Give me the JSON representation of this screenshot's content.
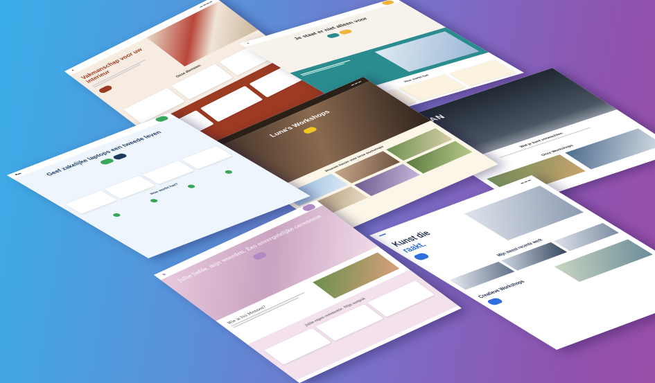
{
  "mockups": {
    "vakmanschap": {
      "headline": "Vakmanschap voor uw interieur",
      "section_title": "Onze diensten",
      "colors": {
        "primary": "#9c3a22",
        "bg": "#f6ece2"
      }
    },
    "coaching": {
      "headline": "Je staat er niet alleen voor",
      "section_title": "Hoe werkt het",
      "colors": {
        "primary": "#2a8c8f",
        "accent": "#f0b43c"
      }
    },
    "urban": {
      "headline": "URBAN",
      "section_title": "Wat je kunt verwachten",
      "section2_title": "Onze Workshops",
      "colors": {
        "dark": "#2b3440",
        "accent": "#f07b2a"
      }
    },
    "workshops": {
      "headline": "Luna's Workshops",
      "section_title": "Waarom kiezen voor onze workshops",
      "colors": {
        "primary": "#f3c623",
        "dark": "#3b2b22"
      }
    },
    "laptops": {
      "headline": "Geef zakelijke laptops een tweede leven",
      "section_title": "Hoe werkt het?",
      "colors": {
        "primary": "#3aa65b",
        "dark": "#1e3a5f"
      }
    },
    "kunst": {
      "headline_line1": "Kunst die",
      "headline_line2": "raakt.",
      "section_title": "Mijn meest recente werk",
      "section2_title": "Creatieve Workshops",
      "colors": {
        "primary": "#2f6fdd",
        "dark": "#1b2a4a"
      }
    },
    "beauty": {
      "headline": "Jullie liefde, mijn woorden. Een onvergetelijke ceremonie",
      "section_title": "Wie is Ivo Mennes?",
      "section2_title": "Jullie eigen ceremonie. Mijn aanpak",
      "colors": {
        "primary": "#b08ac4",
        "bg": "#f3e2ee"
      }
    }
  }
}
